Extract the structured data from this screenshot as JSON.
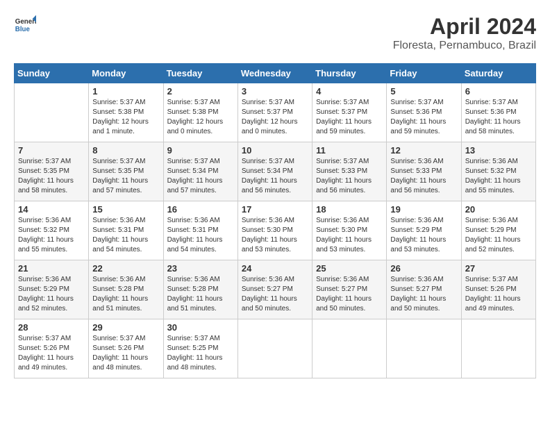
{
  "header": {
    "logo_line1": "General",
    "logo_line2": "Blue",
    "title": "April 2024",
    "subtitle": "Floresta, Pernambuco, Brazil"
  },
  "calendar": {
    "headers": [
      "Sunday",
      "Monday",
      "Tuesday",
      "Wednesday",
      "Thursday",
      "Friday",
      "Saturday"
    ],
    "weeks": [
      [
        {
          "day": "",
          "info": ""
        },
        {
          "day": "1",
          "info": "Sunrise: 5:37 AM\nSunset: 5:38 PM\nDaylight: 12 hours\nand 1 minute."
        },
        {
          "day": "2",
          "info": "Sunrise: 5:37 AM\nSunset: 5:38 PM\nDaylight: 12 hours\nand 0 minutes."
        },
        {
          "day": "3",
          "info": "Sunrise: 5:37 AM\nSunset: 5:37 PM\nDaylight: 12 hours\nand 0 minutes."
        },
        {
          "day": "4",
          "info": "Sunrise: 5:37 AM\nSunset: 5:37 PM\nDaylight: 11 hours\nand 59 minutes."
        },
        {
          "day": "5",
          "info": "Sunrise: 5:37 AM\nSunset: 5:36 PM\nDaylight: 11 hours\nand 59 minutes."
        },
        {
          "day": "6",
          "info": "Sunrise: 5:37 AM\nSunset: 5:36 PM\nDaylight: 11 hours\nand 58 minutes."
        }
      ],
      [
        {
          "day": "7",
          "info": "Sunrise: 5:37 AM\nSunset: 5:35 PM\nDaylight: 11 hours\nand 58 minutes."
        },
        {
          "day": "8",
          "info": "Sunrise: 5:37 AM\nSunset: 5:35 PM\nDaylight: 11 hours\nand 57 minutes."
        },
        {
          "day": "9",
          "info": "Sunrise: 5:37 AM\nSunset: 5:34 PM\nDaylight: 11 hours\nand 57 minutes."
        },
        {
          "day": "10",
          "info": "Sunrise: 5:37 AM\nSunset: 5:34 PM\nDaylight: 11 hours\nand 56 minutes."
        },
        {
          "day": "11",
          "info": "Sunrise: 5:37 AM\nSunset: 5:33 PM\nDaylight: 11 hours\nand 56 minutes."
        },
        {
          "day": "12",
          "info": "Sunrise: 5:36 AM\nSunset: 5:33 PM\nDaylight: 11 hours\nand 56 minutes."
        },
        {
          "day": "13",
          "info": "Sunrise: 5:36 AM\nSunset: 5:32 PM\nDaylight: 11 hours\nand 55 minutes."
        }
      ],
      [
        {
          "day": "14",
          "info": "Sunrise: 5:36 AM\nSunset: 5:32 PM\nDaylight: 11 hours\nand 55 minutes."
        },
        {
          "day": "15",
          "info": "Sunrise: 5:36 AM\nSunset: 5:31 PM\nDaylight: 11 hours\nand 54 minutes."
        },
        {
          "day": "16",
          "info": "Sunrise: 5:36 AM\nSunset: 5:31 PM\nDaylight: 11 hours\nand 54 minutes."
        },
        {
          "day": "17",
          "info": "Sunrise: 5:36 AM\nSunset: 5:30 PM\nDaylight: 11 hours\nand 53 minutes."
        },
        {
          "day": "18",
          "info": "Sunrise: 5:36 AM\nSunset: 5:30 PM\nDaylight: 11 hours\nand 53 minutes."
        },
        {
          "day": "19",
          "info": "Sunrise: 5:36 AM\nSunset: 5:29 PM\nDaylight: 11 hours\nand 53 minutes."
        },
        {
          "day": "20",
          "info": "Sunrise: 5:36 AM\nSunset: 5:29 PM\nDaylight: 11 hours\nand 52 minutes."
        }
      ],
      [
        {
          "day": "21",
          "info": "Sunrise: 5:36 AM\nSunset: 5:29 PM\nDaylight: 11 hours\nand 52 minutes."
        },
        {
          "day": "22",
          "info": "Sunrise: 5:36 AM\nSunset: 5:28 PM\nDaylight: 11 hours\nand 51 minutes."
        },
        {
          "day": "23",
          "info": "Sunrise: 5:36 AM\nSunset: 5:28 PM\nDaylight: 11 hours\nand 51 minutes."
        },
        {
          "day": "24",
          "info": "Sunrise: 5:36 AM\nSunset: 5:27 PM\nDaylight: 11 hours\nand 50 minutes."
        },
        {
          "day": "25",
          "info": "Sunrise: 5:36 AM\nSunset: 5:27 PM\nDaylight: 11 hours\nand 50 minutes."
        },
        {
          "day": "26",
          "info": "Sunrise: 5:36 AM\nSunset: 5:27 PM\nDaylight: 11 hours\nand 50 minutes."
        },
        {
          "day": "27",
          "info": "Sunrise: 5:37 AM\nSunset: 5:26 PM\nDaylight: 11 hours\nand 49 minutes."
        }
      ],
      [
        {
          "day": "28",
          "info": "Sunrise: 5:37 AM\nSunset: 5:26 PM\nDaylight: 11 hours\nand 49 minutes."
        },
        {
          "day": "29",
          "info": "Sunrise: 5:37 AM\nSunset: 5:26 PM\nDaylight: 11 hours\nand 48 minutes."
        },
        {
          "day": "30",
          "info": "Sunrise: 5:37 AM\nSunset: 5:25 PM\nDaylight: 11 hours\nand 48 minutes."
        },
        {
          "day": "",
          "info": ""
        },
        {
          "day": "",
          "info": ""
        },
        {
          "day": "",
          "info": ""
        },
        {
          "day": "",
          "info": ""
        }
      ]
    ]
  }
}
